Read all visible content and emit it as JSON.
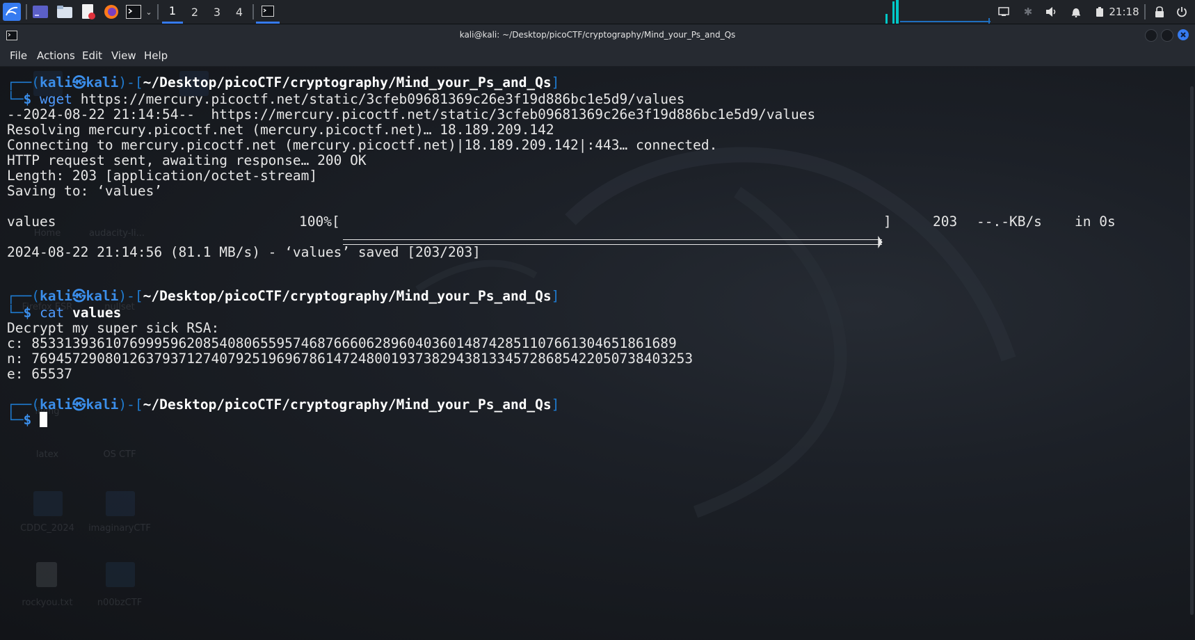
{
  "panel": {
    "workspaces": [
      "1",
      "2",
      "3",
      "4"
    ],
    "active_workspace": "1",
    "clock": "21:18",
    "icons": [
      "kali-menu-icon",
      "desktop-icon",
      "file-manager-icon",
      "text-editor-icon",
      "firefox-icon",
      "terminal-icon",
      "chevron-down-icon",
      "terminal-task-icon",
      "network-icon",
      "bluetooth-icon",
      "volume-icon",
      "notification-bell-icon",
      "battery-icon",
      "lock-icon",
      "power-icon"
    ]
  },
  "window": {
    "title": "kali@kali: ~/Desktop/picoCTF/cryptography/Mind_your_Ps_and_Qs",
    "menu": [
      "File",
      "Actions",
      "Edit",
      "View",
      "Help"
    ]
  },
  "desktop_icons": [
    "Home",
    "audacity-li...",
    "Firefox ESR",
    "nullset",
    "living",
    "latex",
    "OS CTF",
    "CDDC_2024",
    "imaginaryCTF",
    "rockyou.txt",
    "n00bzCTF"
  ],
  "terminal": {
    "prompt_user": "kali",
    "prompt_at": "㉿",
    "prompt_host": "kali",
    "prompt_path": "~/Desktop/picoCTF/cryptography/Mind_your_Ps_and_Qs",
    "cmd1_name": "wget",
    "cmd1_arg": "https://mercury.picoctf.net/static/3cfeb09681369c26e3f19d886bc1e5d9/values",
    "out1": [
      "--2024-08-22 21:14:54--  https://mercury.picoctf.net/static/3cfeb09681369c26e3f19d886bc1e5d9/values",
      "Resolving mercury.picoctf.net (mercury.picoctf.net)… 18.189.209.142",
      "Connecting to mercury.picoctf.net (mercury.picoctf.net)|18.189.209.142|:443… connected.",
      "HTTP request sent, awaiting response… 200 OK",
      "Length: 203 [application/octet-stream]",
      "Saving to: ‘values’"
    ],
    "progress": {
      "name": "values",
      "percent": "100%[",
      "close": "]",
      "bytes": "203",
      "speed": "--.-KB/s",
      "time": "in 0s",
      "fraction": 1.0
    },
    "saved_line": "2024-08-22 21:14:56 (81.1 MB/s) - ‘values’ saved [203/203]",
    "cmd2_name": "cat",
    "cmd2_arg": "values",
    "out2": [
      "Decrypt my super sick RSA:",
      "c: 8533139361076999596208540806559574687666062896040360148742851107661304651861689",
      "n: 769457290801263793712740792519696786147248001937382943813345728685422050738403253",
      "e: 65537"
    ]
  }
}
